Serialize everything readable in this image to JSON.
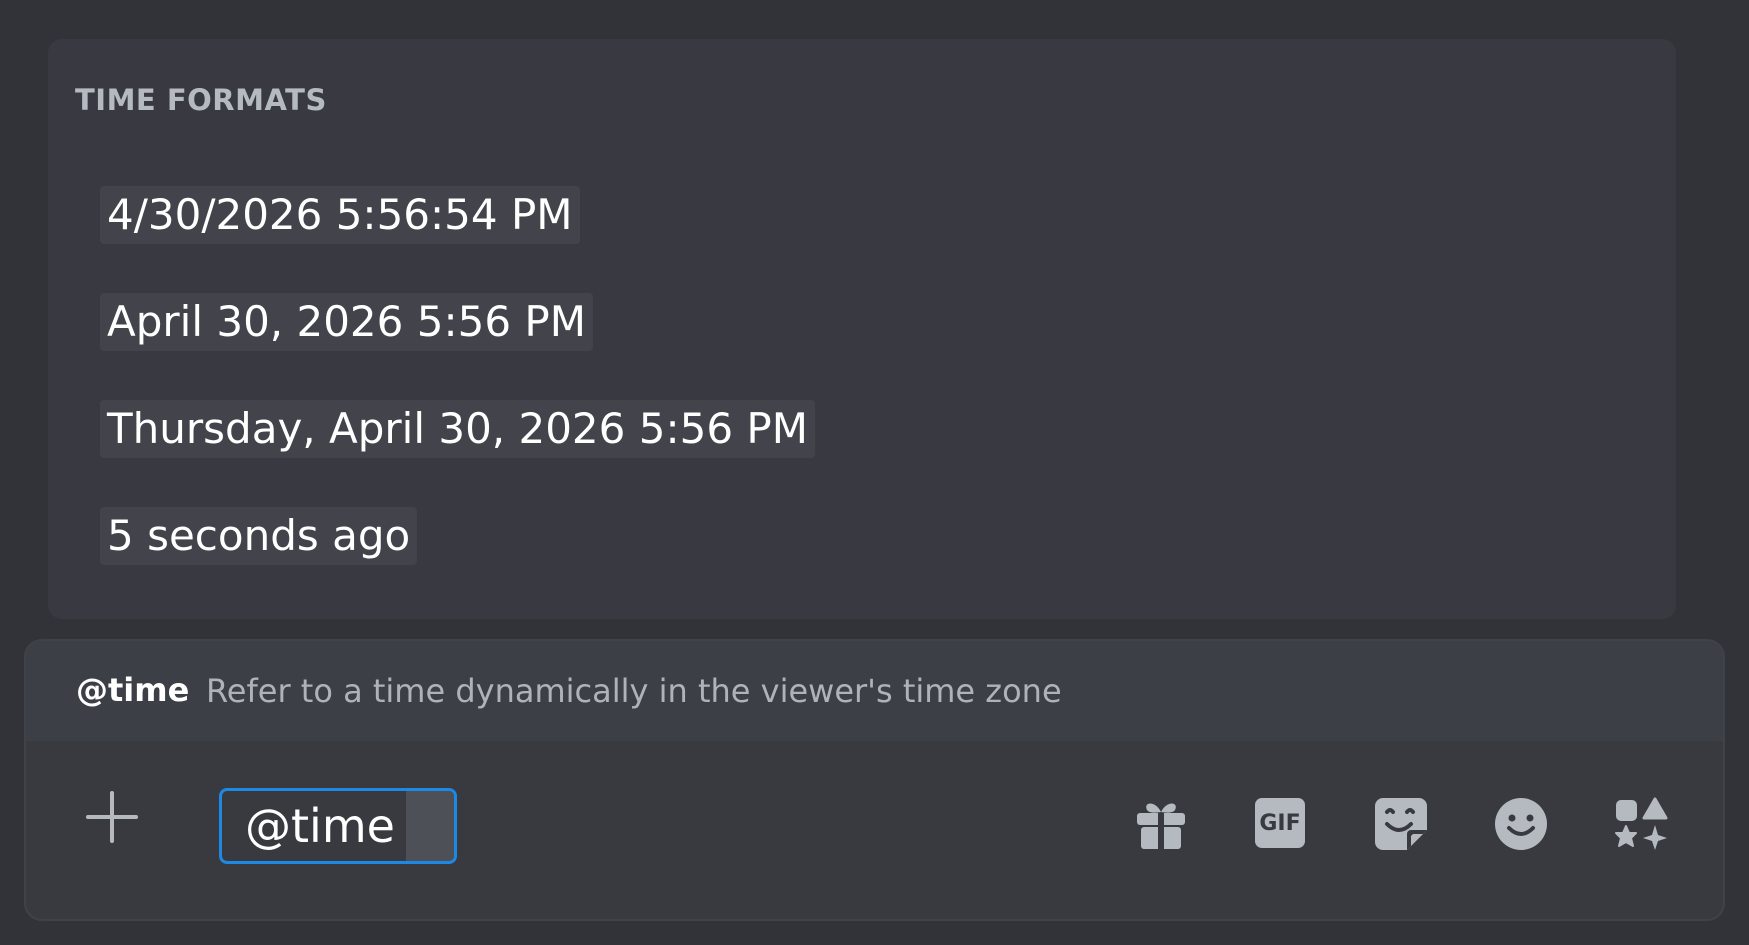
{
  "popup": {
    "header": "TIME FORMATS",
    "options": [
      "4/30/2026 5:56:54 PM",
      "April 30, 2026 5:56 PM",
      "Thursday, April 30, 2026 5:56 PM",
      "5 seconds ago"
    ]
  },
  "hint": {
    "token": "@time",
    "description": "Refer to a time dynamically in the viewer's time zone"
  },
  "composer": {
    "input_value": "@time",
    "gif_label": "GIF",
    "icons": [
      "plus-icon",
      "gift-icon",
      "gif-icon",
      "sticker-icon",
      "emoji-icon",
      "apps-icon"
    ]
  },
  "colors": {
    "background": "#313338",
    "popup": "#393a41",
    "option_highlight": "#43444b",
    "input_border": "#1e88e5",
    "icon": "#b5bac1"
  }
}
